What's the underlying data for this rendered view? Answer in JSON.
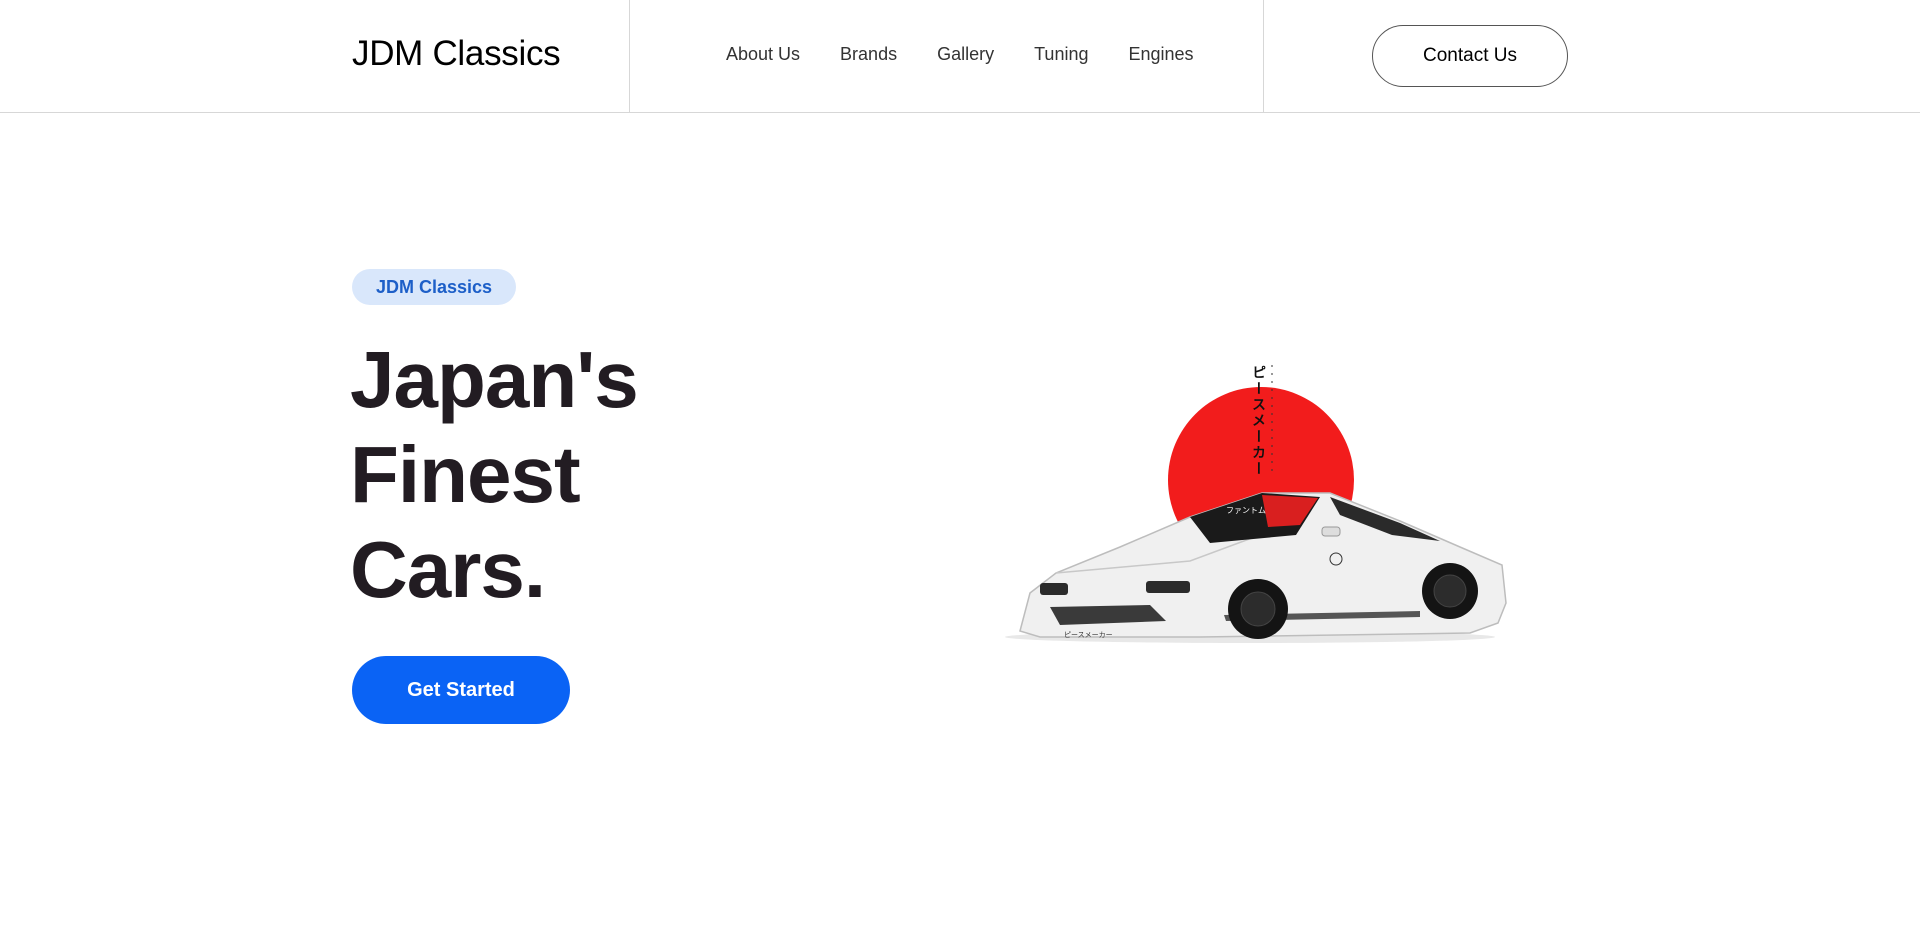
{
  "header": {
    "logo": "JDM Classics",
    "nav": [
      "About Us",
      "Brands",
      "Gallery",
      "Tuning",
      "Engines"
    ],
    "contact_label": "Contact Us"
  },
  "hero": {
    "badge": "JDM Classics",
    "title_lines": [
      "Japan's",
      "Finest",
      "Cars."
    ],
    "cta_label": "Get Started",
    "art_text_vertical": "ピースメーカー",
    "art_text_windshield": "ファントム",
    "art_text_bumper": "ピースメーカー"
  },
  "colors": {
    "accent": "#0a63f5",
    "badge_bg": "#d9e7fb",
    "badge_text": "#1d5fc8",
    "sun": "#f21c1c",
    "headline": "#221c22"
  }
}
